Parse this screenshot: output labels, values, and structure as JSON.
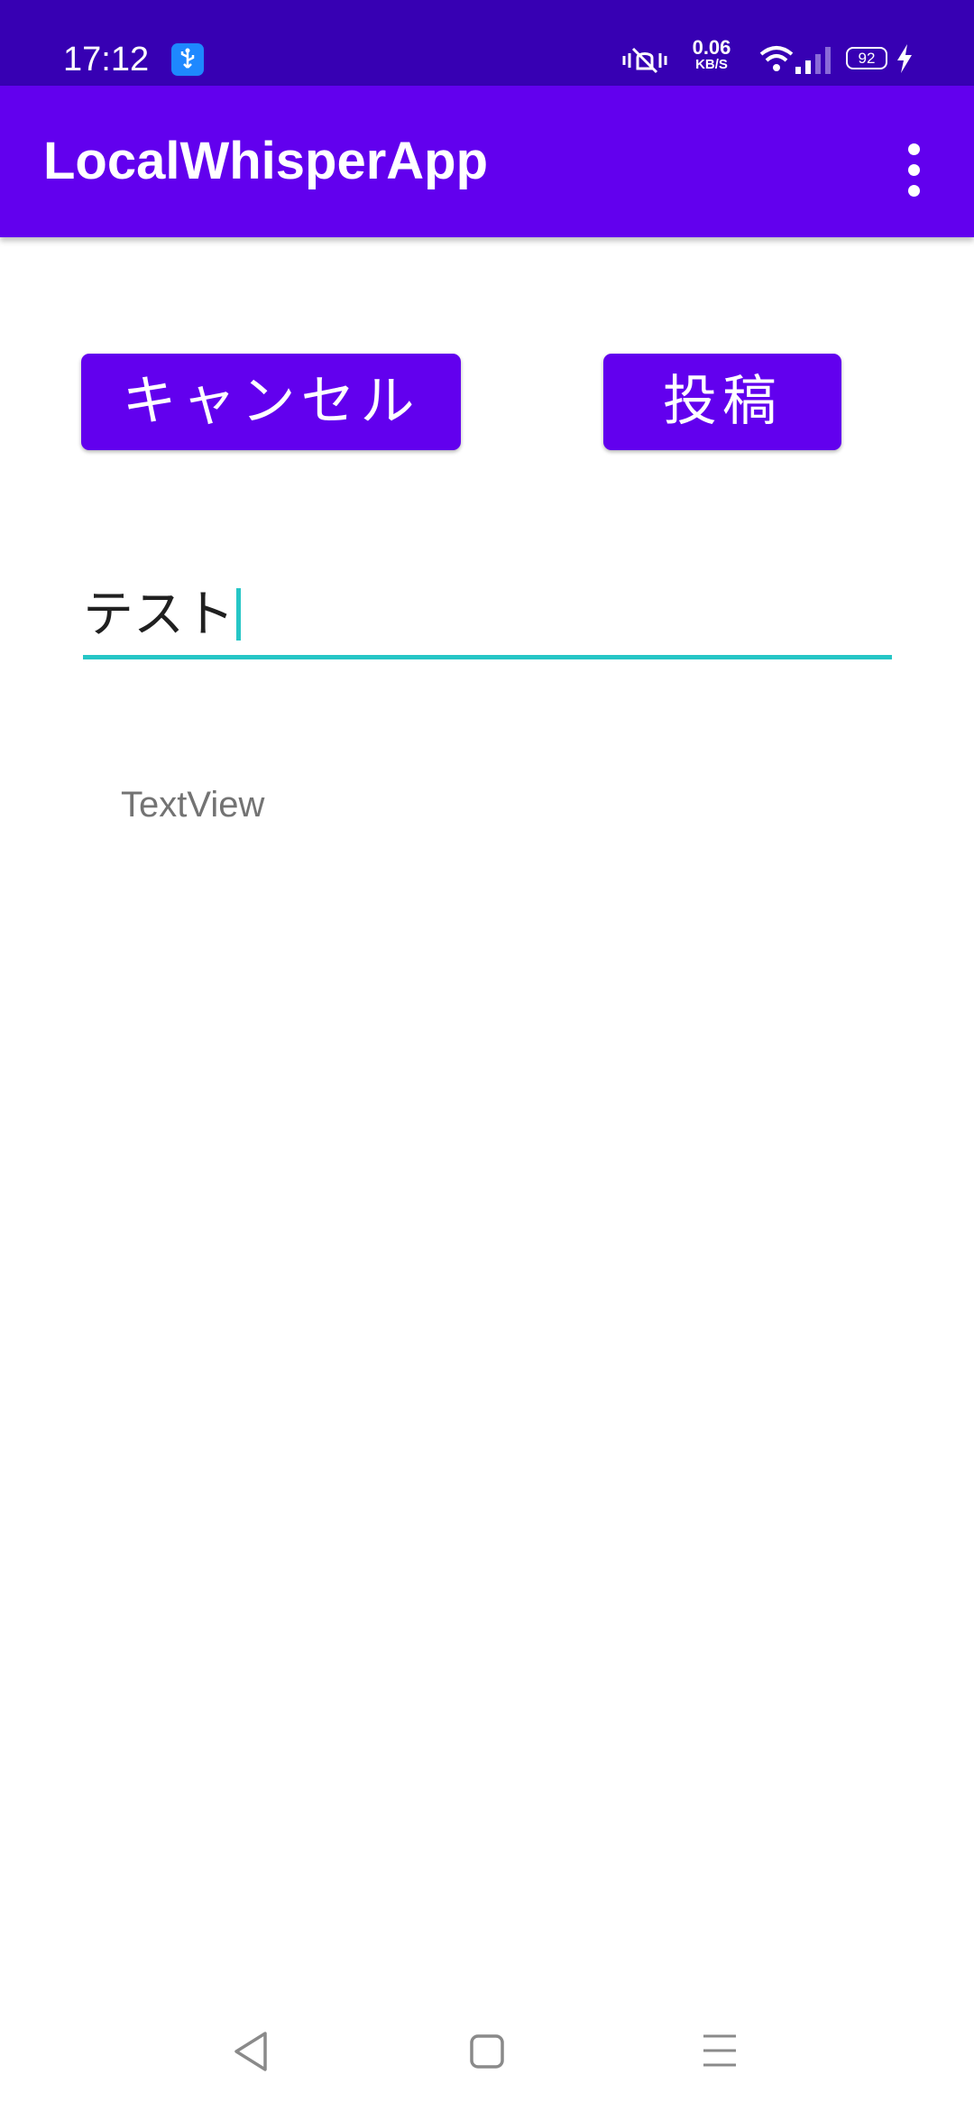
{
  "status_bar": {
    "time": "17:12",
    "net_speed_value": "0.06",
    "net_speed_unit": "KB/S",
    "battery_level": "92",
    "icons": [
      "usb-icon",
      "vibrate-mute-icon",
      "wifi-icon",
      "signal-icon",
      "battery-icon",
      "charging-bolt-icon"
    ]
  },
  "app_bar": {
    "title": "LocalWhisperApp",
    "menu_icon": "more-vert-icon"
  },
  "buttons": {
    "cancel_label": "キャンセル",
    "post_label": "投稿"
  },
  "input": {
    "value": "テスト"
  },
  "textview": {
    "text": "TextView"
  },
  "nav_bar": {
    "icons": [
      "back-icon",
      "home-icon",
      "recents-icon"
    ]
  },
  "colors": {
    "status_bar": "#3700b3",
    "primary": "#6200ee",
    "accent": "#26c6c6",
    "background": "#ffffff"
  }
}
